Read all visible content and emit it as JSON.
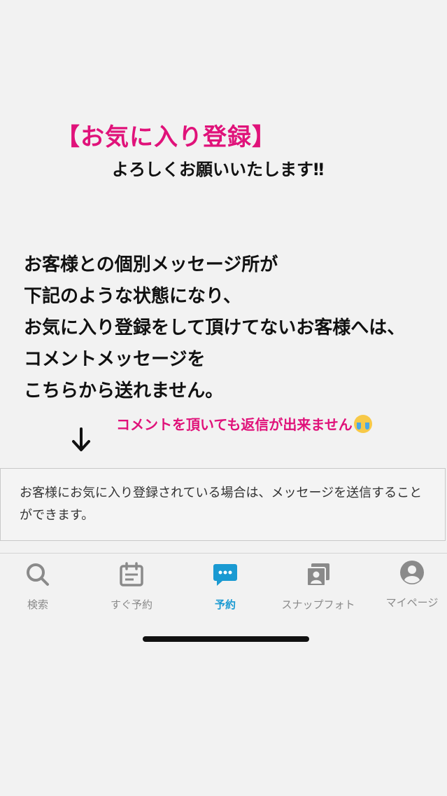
{
  "announcement": {
    "title": "【お気に入り登録】",
    "subtitle": "よろしくお願いいたします‼",
    "body_lines": [
      "お客様との個別メッセージ所が",
      "下記のような状態になり、",
      "お気に入り登録をして頂けてないお客様へは、",
      "コメントメッセージを",
      "こちらから送れません。"
    ],
    "note": "コメントを頂いても返信が出来ません",
    "note_emoji": "loudly-crying-face-emoji"
  },
  "message_notice": {
    "text": "お客様にお気に入り登録されている場合は、メッセージを送信することができます。"
  },
  "tab_bar": {
    "active_tab": "予約",
    "accent_color": "#1a9ad2",
    "tabs": [
      {
        "label": "検索",
        "icon": "search-icon"
      },
      {
        "label": "すぐ予約",
        "icon": "calendar-icon"
      },
      {
        "label": "予約",
        "icon": "chat-bubble-icon"
      },
      {
        "label": "スナップフォト",
        "icon": "photo-icon"
      },
      {
        "label": "マイページ",
        "icon": "user-icon"
      }
    ]
  },
  "colors": {
    "highlight_pink": "#e0127a",
    "background": "#f2f2f2"
  }
}
